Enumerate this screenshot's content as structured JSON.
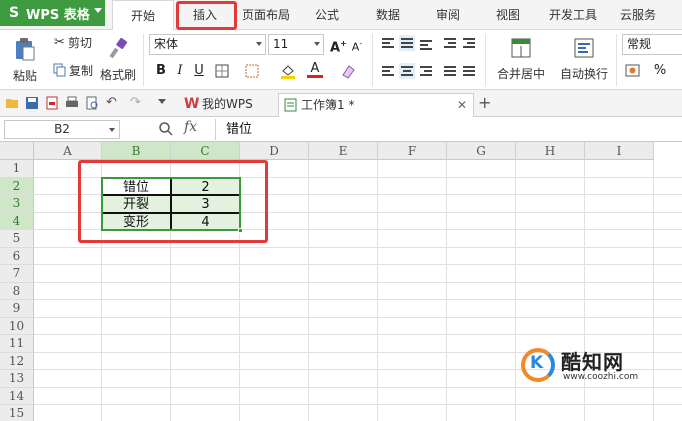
{
  "app": {
    "name": "WPS 表格",
    "logo_letter": "S"
  },
  "ribbon_tabs": [
    "开始",
    "插入",
    "页面布局",
    "公式",
    "数据",
    "审阅",
    "视图",
    "开发工具",
    "云服务"
  ],
  "active_tab": "开始",
  "highlighted_tab": "插入",
  "toolbar": {
    "paste": "粘贴",
    "cut": "剪切",
    "copy": "复制",
    "format_painter": "格式刷",
    "font_name": "宋体",
    "font_size": "11",
    "bold": "B",
    "italic": "I",
    "underline": "U",
    "font_color_letter": "A",
    "merge_center": "合并居中",
    "wrap_text": "自动换行",
    "number_format": "常规",
    "percent": "%"
  },
  "quick_access": {
    "doc_tabs": [
      {
        "label": "我的WPS"
      },
      {
        "label": "工作簿1 *"
      }
    ],
    "new_tab_symbol": "+"
  },
  "formula_bar": {
    "cell_ref": "B2",
    "fx": "fx",
    "content": "错位"
  },
  "sheet": {
    "columns": [
      "A",
      "B",
      "C",
      "D",
      "E",
      "F",
      "G",
      "H",
      "I"
    ],
    "rows": [
      "1",
      "2",
      "3",
      "4",
      "5",
      "6",
      "7",
      "8",
      "9",
      "10",
      "11",
      "12",
      "13",
      "14",
      "15"
    ],
    "cells": [
      {
        "ref": "B2",
        "value": "错位"
      },
      {
        "ref": "C2",
        "value": "2"
      },
      {
        "ref": "B3",
        "value": "开裂"
      },
      {
        "ref": "C3",
        "value": "3"
      },
      {
        "ref": "B4",
        "value": "变形"
      },
      {
        "ref": "C4",
        "value": "4"
      }
    ],
    "selection": "B2:C4"
  },
  "watermark": {
    "name": "酷知网",
    "url": "www.coozhi.com",
    "mark": "K"
  },
  "colors": {
    "app_green": "#3f9b3f",
    "selection_green": "#3a9a3a",
    "highlight_red": "#e13a3a"
  }
}
